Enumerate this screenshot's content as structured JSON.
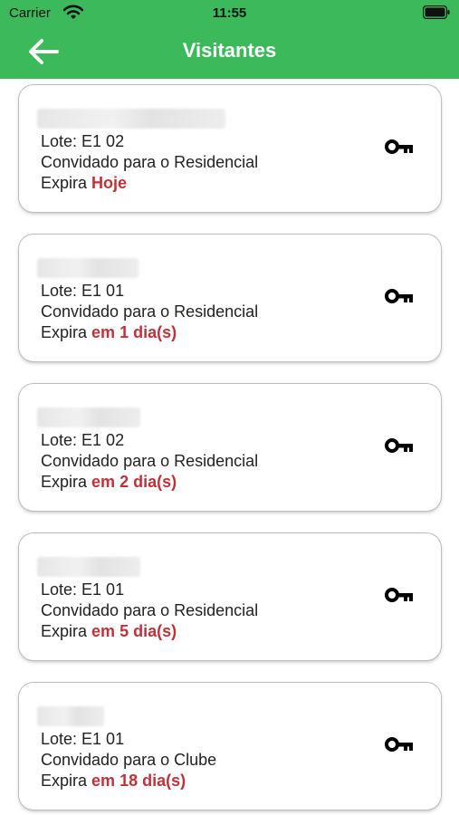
{
  "status_bar": {
    "carrier": "Carrier",
    "time": "11:55"
  },
  "header": {
    "title": "Visitantes",
    "back_icon": "arrow-left-icon",
    "background": "#3cb95b"
  },
  "accent_red": "#c0323a",
  "visitors": [
    {
      "lote": "Lote: E1 02",
      "invite": "Convidado para o Residencial",
      "expira_label": "Expira",
      "expira_value": "Hoje"
    },
    {
      "lote": "Lote: E1 01",
      "invite": "Convidado para o Residencial",
      "expira_label": "Expira",
      "expira_value": "em 1 dia(s)"
    },
    {
      "lote": "Lote: E1 02",
      "invite": "Convidado para o Residencial",
      "expira_label": "Expira",
      "expira_value": "em 2 dia(s)"
    },
    {
      "lote": "Lote: E1 01",
      "invite": "Convidado para o Residencial",
      "expira_label": "Expira",
      "expira_value": "em 5 dia(s)"
    },
    {
      "lote": "Lote: E1 01",
      "invite": "Convidado para o Clube",
      "expira_label": "Expira",
      "expira_value": "em 18 dia(s)"
    }
  ]
}
